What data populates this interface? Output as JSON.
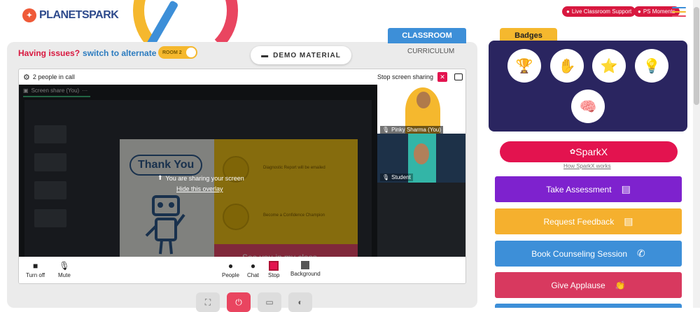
{
  "brand": {
    "logo_text": "PLANETSPARK"
  },
  "header": {
    "live_support": "Live Classroom Support",
    "ps_moments": "PS Moments"
  },
  "tabs": {
    "classroom": "CLASSROOM",
    "curriculum": "CURRICULUM"
  },
  "issues": {
    "text": "Having issues?",
    "switch": "switch to alternate room",
    "toggle_label": "ROOM 2"
  },
  "demo": {
    "label": "DEMO MATERIAL"
  },
  "call": {
    "people": "2 people in call",
    "stop_sharing": "Stop screen sharing",
    "share_label": "Screen share (You)"
  },
  "overlay": {
    "sharing": "You are sharing your screen",
    "hide": "Hide this overlay"
  },
  "slide": {
    "thank_you": "Thank You",
    "diag": "Diagnostic Report will be emailed",
    "champ": "Become a Confidence Champion",
    "see_you": "See you in my class"
  },
  "participants": [
    {
      "name": "Pinky Sharma (You)"
    },
    {
      "name": "Student"
    }
  ],
  "controls": {
    "turn_off": "Turn off",
    "mute": "Mute",
    "people": "People",
    "chat": "Chat",
    "stop": "Stop",
    "background": "Background"
  },
  "badges": {
    "title": "Badges"
  },
  "sparkx": {
    "label": "SparkX",
    "how": "How SparkX works"
  },
  "actions": [
    {
      "label": "Take Assessment",
      "color": "#7e22ce"
    },
    {
      "label": "Request Feedback",
      "color": "#f5b02e"
    },
    {
      "label": "Book Counseling Session",
      "color": "#3d8fd8"
    },
    {
      "label": "Give Applause",
      "color": "#d8395f"
    }
  ]
}
